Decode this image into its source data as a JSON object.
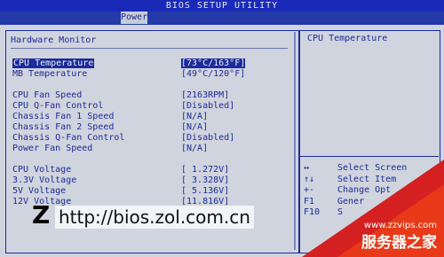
{
  "header": {
    "title": "BIOS SETUP UTILITY",
    "tab": "Power"
  },
  "panel": {
    "heading": "Hardware Monitor"
  },
  "rows": [
    {
      "label": "CPU Temperature",
      "value": "[73°C/163°F]"
    },
    {
      "label": "MB Temperature",
      "value": "[49°C/120°F]"
    },
    {
      "label": "CPU Fan Speed",
      "value": "[2163RPM]"
    },
    {
      "label": "CPU Q-Fan Control",
      "value": "[Disabled]"
    },
    {
      "label": "Chassis Fan 1 Speed",
      "value": "[N/A]"
    },
    {
      "label": "Chassis Fan 2 Speed",
      "value": "[N/A]"
    },
    {
      "label": "Chassis Q-Fan Control",
      "value": "[Disabled]"
    },
    {
      "label": "Power Fan Speed",
      "value": "[N/A]"
    },
    {
      "label": "CPU Voltage",
      "value": "[ 1.272V]"
    },
    {
      "label": "3.3V  Voltage",
      "value": "[ 3.328V]"
    },
    {
      "label": "5V  Voltage",
      "value": "[ 5.136V]"
    },
    {
      "label": "12V  Voltage",
      "value": "[11.816V]"
    }
  ],
  "help": {
    "title": "CPU Temperature",
    "keys": [
      {
        "key": "↔",
        "desc": "Select Screen"
      },
      {
        "key": "↑↓",
        "desc": "Select Item"
      },
      {
        "key": "+-",
        "desc": "Change Opt"
      },
      {
        "key": "F1",
        "desc": "Gener"
      },
      {
        "key": "F10",
        "desc": "S"
      }
    ]
  },
  "watermarks": {
    "logo": "Z",
    "url": "http://bios.zol.com.cn",
    "site_url": "www.zzvips.com",
    "site_name": "服务器之家"
  }
}
